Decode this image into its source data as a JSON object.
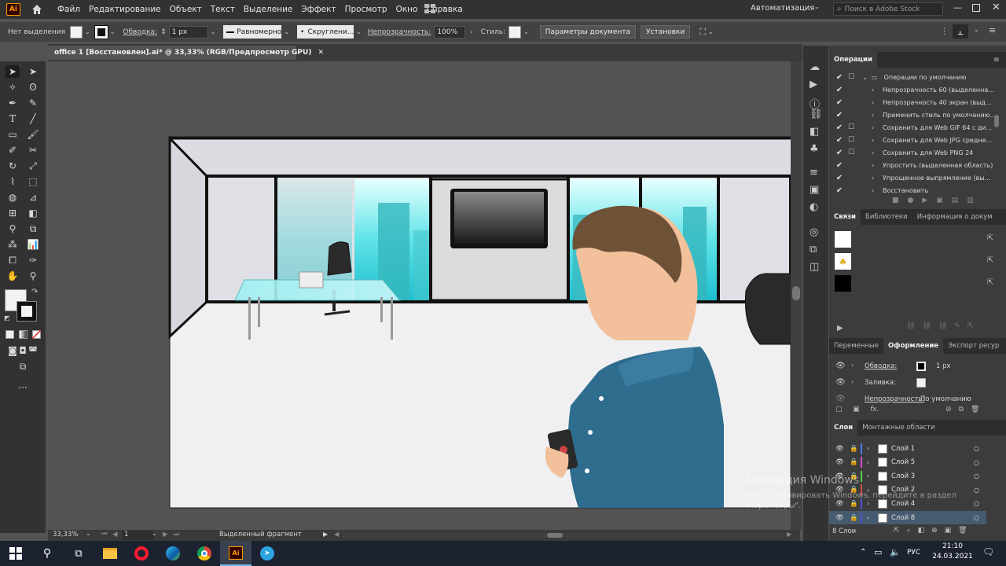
{
  "menubar": {
    "app_logo": "Ai",
    "items": [
      "Файл",
      "Редактирование",
      "Объект",
      "Текст",
      "Выделение",
      "Эффект",
      "Просмотр",
      "Окно",
      "Справка"
    ],
    "workspace": "Автоматизация",
    "search_placeholder": "Поиск в Adobe Stock"
  },
  "control": {
    "selection": "Нет выделения",
    "stroke_label": "Обводка:",
    "stroke_value": "1 px",
    "stroke_style": "Равномерно",
    "brush": "Скруглени...",
    "opacity_label": "Непрозрачность:",
    "opacity_value": "100%",
    "style_label": "Стиль:",
    "doc_settings": "Параметры документа",
    "prefs": "Установки"
  },
  "document": {
    "tab": "office 1 [Восстановлен].ai* @ 33,33% (RGB/Предпросмотр GPU)",
    "zoom": "33,33%",
    "artboard_num": "1",
    "status_text": "Выделенный фрагмент"
  },
  "actions_panel": {
    "title": "Операции",
    "rows": [
      "Операции по умолчанию",
      "Непрозрачность 60 (выделенна...",
      "Непрозрачность 40 экран (выд...",
      "Применить стиль по умолчанию...",
      "Сохранить для Web GIF 64 с ди...",
      "Сохранить для Web JPG средне...",
      "Сохранить для Web PNG 24",
      "Упростить (выделенная область)",
      "Упрощенное выпрямление (вы...",
      "Восстановить"
    ]
  },
  "links_panel": {
    "tabs": [
      "Связи",
      "Библиотеки",
      "Информация о докум"
    ]
  },
  "appearance_panel": {
    "tabs": [
      "Переменные",
      "Оформление",
      "Экспорт ресур"
    ],
    "stroke_label": "Обводка:",
    "stroke_value": "1 px",
    "fill_label": "Заливка:",
    "opacity_label": "Непрозрачность:",
    "opacity_value": "По умолчанию",
    "fx": "fx."
  },
  "layers_panel": {
    "tabs": [
      "Слои",
      "Монтажные области"
    ],
    "layers": [
      {
        "name": "Слой 1",
        "color": "#4f7bff"
      },
      {
        "name": "Слой 5",
        "color": "#d24fd2"
      },
      {
        "name": "Слой 3",
        "color": "#4fd24f"
      },
      {
        "name": "Слой 2",
        "color": "#d24f4f"
      },
      {
        "name": "Слой 4",
        "color": "#4f4fd2"
      },
      {
        "name": "Слой 8",
        "color": "#4f4fd2"
      }
    ],
    "count": "8 Слои"
  },
  "watermark": {
    "title": "Активация Windows",
    "line1": "Чтобы активировать Windows, перейдите в раздел",
    "line2": "\"Параметры\"."
  },
  "taskbar": {
    "lang": "РУС",
    "time": "21:10",
    "date": "24.03.2021"
  }
}
